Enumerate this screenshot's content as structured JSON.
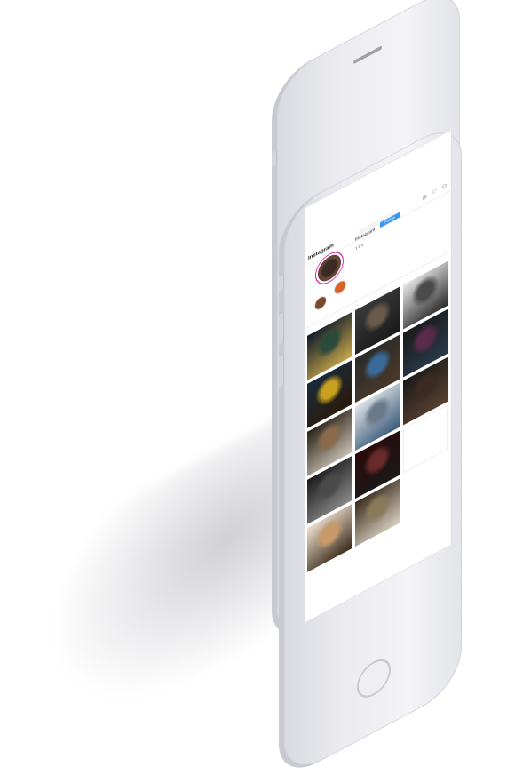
{
  "app": {
    "name": "Instagram",
    "logo_text": "Instagram"
  },
  "header": {
    "icons": [
      "compass-icon",
      "heart-icon",
      "person-icon"
    ]
  },
  "profile": {
    "username": "Instagram",
    "follow_label": "Follow",
    "stats": "1 2 3",
    "bio_lines": [
      "",
      "",
      ""
    ],
    "bio_link": ""
  },
  "highlights": [
    {
      "label": "",
      "color": "#7a4a2a"
    },
    {
      "label": "",
      "color": "#d9622b"
    }
  ],
  "tabs": [
    "",
    "",
    ""
  ],
  "grid_tiles": [
    {
      "kind": "photo",
      "colors": [
        "#0f1a2a",
        "#2a4a3a",
        "#c8a84a"
      ]
    },
    {
      "kind": "photo",
      "colors": [
        "#3a3a3a",
        "#6b5a4a",
        "#1a1a1a"
      ]
    },
    {
      "kind": "photo",
      "colors": [
        "#e8e8e8",
        "#4a4a4a",
        "#2a2a2a"
      ]
    },
    {
      "kind": "photo",
      "colors": [
        "#1a2a3a",
        "#c8a020",
        "#2a1a0a"
      ]
    },
    {
      "kind": "photo",
      "colors": [
        "#2a2a2a",
        "#3a6a9a",
        "#4a3a2a"
      ]
    },
    {
      "kind": "photo",
      "colors": [
        "#1a1a1a",
        "#5a2a4a",
        "#2a3a4a"
      ]
    },
    {
      "kind": "photo",
      "colors": [
        "#2a2218",
        "#8a6a4a",
        "#c8c0b0"
      ]
    },
    {
      "kind": "photo",
      "colors": [
        "#e0e4e8",
        "#6a7a8a",
        "#3a5a7a"
      ]
    },
    {
      "kind": "photo",
      "colors": [
        "#1a1a1a",
        "#3a2a20",
        "#5a4030"
      ]
    },
    {
      "kind": "photo",
      "colors": [
        "#1a1a1a",
        "#4a4a4a",
        "#8a8a8a"
      ]
    },
    {
      "kind": "photo",
      "colors": [
        "#2a0a0a",
        "#6a2a2a",
        "#1a1a1a"
      ]
    },
    {
      "kind": "post",
      "text": ""
    },
    {
      "kind": "photo",
      "colors": [
        "#f0e0d0",
        "#c89a6a",
        "#3a2a1a"
      ]
    },
    {
      "kind": "photo",
      "colors": [
        "#3a2a1a",
        "#8a7a5a",
        "#d8d0c0"
      ]
    }
  ]
}
